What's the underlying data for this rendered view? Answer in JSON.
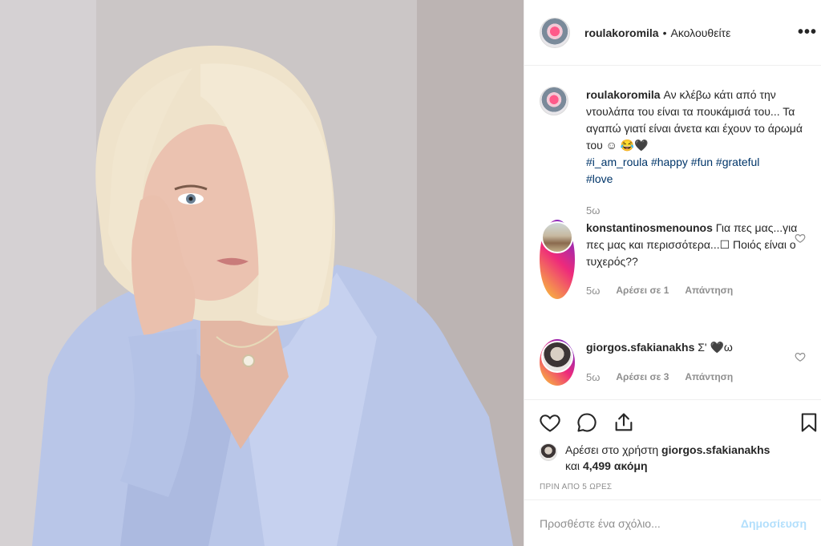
{
  "post": {
    "username": "roulakoromila",
    "separator": "•",
    "follow_status": "Ακολουθείτε",
    "more_glyph": "•••"
  },
  "caption": {
    "username": "roulakoromila",
    "text": "Αν κλέβω κάτι από την ντουλάπα του είναι τα πουκάμισά του... Τα αγαπώ γιατί είναι άνετα και έχουν το άρωμά του ☺ 😂🖤",
    "hashtags": [
      "#i_am_roula",
      "#happy",
      "#fun",
      "#grateful",
      "#love"
    ],
    "age": "5ω"
  },
  "comments": [
    {
      "username": "konstantinosmenounos",
      "text": "Για πες μας...για πες μας και περισσότερα...☐ Ποιός είναι ο τυχερός??",
      "age": "5ω",
      "likes": "Αρέσει σε 1",
      "reply": "Απάντηση"
    },
    {
      "username": "giorgos.sfakianakhs",
      "text": "Σ' 🖤ω",
      "age": "5ω",
      "likes": "Αρέσει σε 3",
      "reply": "Απάντηση"
    }
  ],
  "likes_line": {
    "prefix": "Αρέσει στο χρήστη",
    "user": "giorgos.sfakianakhs",
    "and": "και",
    "count": "4,499",
    "suffix": "ακόμη"
  },
  "timestamp": "ΠΡΙΝ ΑΠΟ 5 ΩΡΕΣ",
  "add_comment": {
    "placeholder": "Προσθέστε ένα σχόλιο...",
    "post_label": "Δημοσίευση"
  },
  "icons": {
    "like": "heart-icon",
    "comment": "comment-icon",
    "share": "share-icon",
    "save": "bookmark-icon"
  },
  "colors": {
    "text": "#262626",
    "muted": "#8e8e8e",
    "hashtag": "#003569",
    "post_disabled": "#b2dffc"
  }
}
